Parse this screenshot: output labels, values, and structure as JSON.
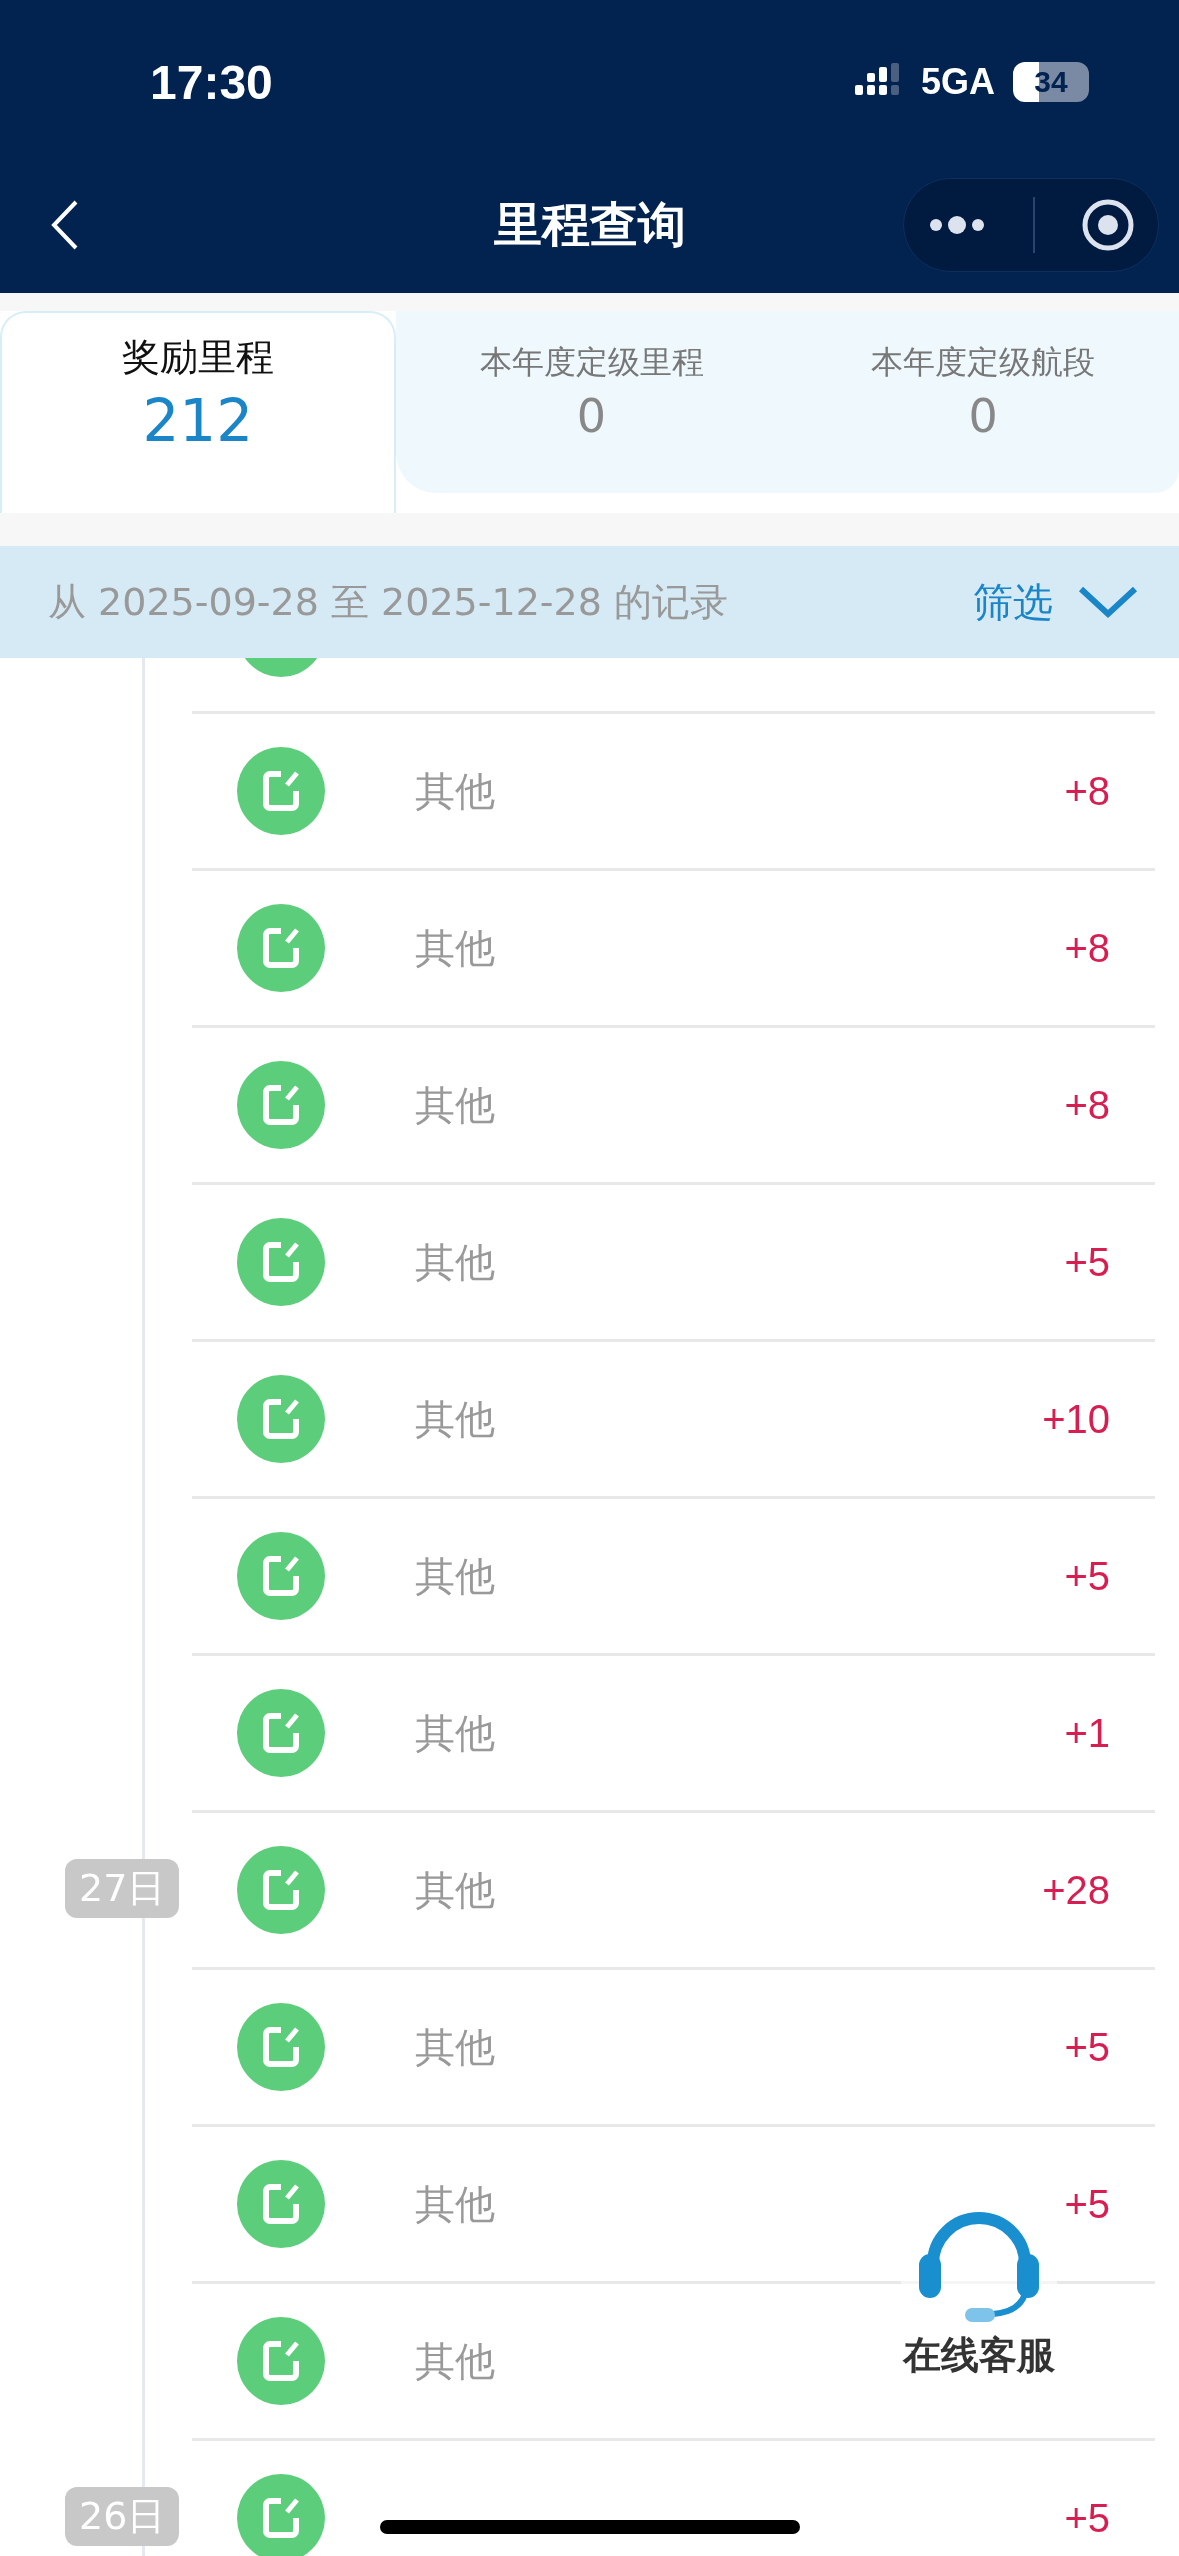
{
  "status_bar": {
    "time": "17:30",
    "network": "5GA",
    "battery": "34"
  },
  "nav": {
    "title": "里程查询"
  },
  "tabs": [
    {
      "label": "奖励里程",
      "value": "212",
      "selected": true
    },
    {
      "label": "本年度定级里程",
      "value": "0",
      "selected": false
    },
    {
      "label": "本年度定级航段",
      "value": "0",
      "selected": false
    }
  ],
  "filter": {
    "range": "从 2025-09-28 至 2025-12-28 的记录",
    "button": "筛选"
  },
  "records": [
    {
      "kind": "partial"
    },
    {
      "kind": "entry",
      "label": "其他",
      "amount": "+8"
    },
    {
      "kind": "entry",
      "label": "其他",
      "amount": "+8"
    },
    {
      "kind": "entry",
      "label": "其他",
      "amount": "+8"
    },
    {
      "kind": "entry",
      "label": "其他",
      "amount": "+5"
    },
    {
      "kind": "entry",
      "label": "其他",
      "amount": "+10"
    },
    {
      "kind": "entry",
      "label": "其他",
      "amount": "+5"
    },
    {
      "kind": "entry",
      "label": "其他",
      "amount": "+1"
    },
    {
      "kind": "entry",
      "date": "27日",
      "label": "其他",
      "amount": "+28"
    },
    {
      "kind": "entry",
      "label": "其他",
      "amount": "+5"
    },
    {
      "kind": "entry",
      "label": "其他",
      "amount": "+5"
    },
    {
      "kind": "entry",
      "label": "其他"
    },
    {
      "kind": "entry",
      "date": "26日",
      "amount": "+5"
    }
  ],
  "support": {
    "label": "在线客服"
  }
}
